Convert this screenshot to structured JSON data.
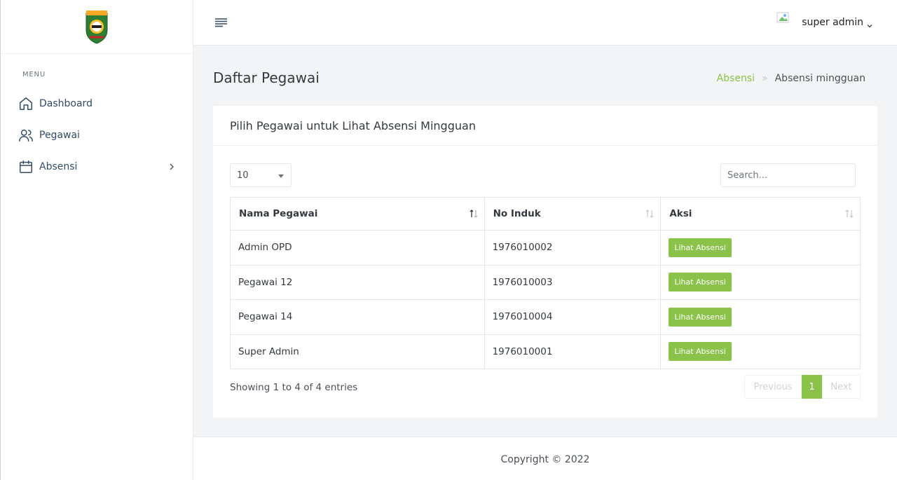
{
  "sidebar": {
    "menu_title": "MENU",
    "items": [
      {
        "label": "Dashboard",
        "icon": "home-icon"
      },
      {
        "label": "Pegawai",
        "icon": "users-icon"
      },
      {
        "label": "Absensi",
        "icon": "calendar-icon"
      }
    ]
  },
  "topbar": {
    "user_name": "super admin"
  },
  "page": {
    "title": "Daftar Pegawai",
    "breadcrumb": {
      "link": "Absensi",
      "separator": "»",
      "current": "Absensi mingguan"
    }
  },
  "card": {
    "title": "Pilih Pegawai untuk Lihat Absensi Mingguan",
    "length_value": "10",
    "search_placeholder": "Search...",
    "columns": [
      "Nama Pegawai",
      "No Induk",
      "Aksi"
    ],
    "rows": [
      {
        "nama": "Admin OPD",
        "no_induk": "1976010002",
        "aksi": "Lihat Absensi"
      },
      {
        "nama": "Pegawai 12",
        "no_induk": "1976010003",
        "aksi": "Lihat Absensi"
      },
      {
        "nama": "Pegawai 14",
        "no_induk": "1976010004",
        "aksi": "Lihat Absensi"
      },
      {
        "nama": "Super Admin",
        "no_induk": "1976010001",
        "aksi": "Lihat Absensi"
      }
    ],
    "info": "Showing 1 to 4 of 4 entries",
    "pagination": {
      "previous": "Previous",
      "page": "1",
      "next": "Next"
    }
  },
  "footer": {
    "text": "Copyright © 2022"
  },
  "colors": {
    "accent": "#8bc34a",
    "nav_text": "#344a66"
  }
}
